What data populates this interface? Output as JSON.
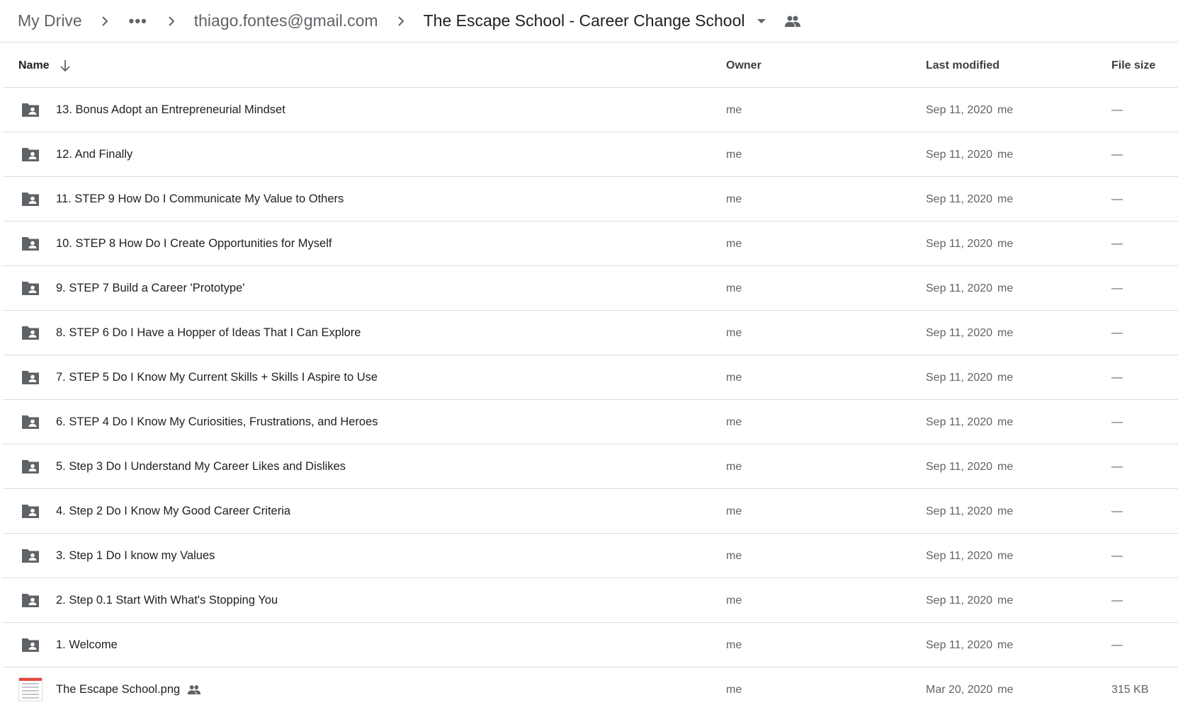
{
  "breadcrumb": {
    "root": "My Drive",
    "overflow": "•••",
    "account": "thiago.fontes@gmail.com",
    "current": "The Escape School - Career Change School"
  },
  "columns": {
    "name": "Name",
    "owner": "Owner",
    "last_modified": "Last modified",
    "file_size": "File size"
  },
  "rows": [
    {
      "name": "13. Bonus Adopt an Entrepreneurial Mindset",
      "owner": "me",
      "date": "Sep 11, 2020",
      "by": "me",
      "size": "—",
      "type": "shared-folder"
    },
    {
      "name": "12. And Finally",
      "owner": "me",
      "date": "Sep 11, 2020",
      "by": "me",
      "size": "—",
      "type": "shared-folder"
    },
    {
      "name": "11. STEP 9 How Do I Communicate My Value to Others",
      "owner": "me",
      "date": "Sep 11, 2020",
      "by": "me",
      "size": "—",
      "type": "shared-folder"
    },
    {
      "name": "10. STEP 8 How Do I Create Opportunities for Myself",
      "owner": "me",
      "date": "Sep 11, 2020",
      "by": "me",
      "size": "—",
      "type": "shared-folder"
    },
    {
      "name": "9. STEP 7 Build a Career 'Prototype'",
      "owner": "me",
      "date": "Sep 11, 2020",
      "by": "me",
      "size": "—",
      "type": "shared-folder"
    },
    {
      "name": "8. STEP 6 Do I Have a Hopper of Ideas That I Can Explore",
      "owner": "me",
      "date": "Sep 11, 2020",
      "by": "me",
      "size": "—",
      "type": "shared-folder"
    },
    {
      "name": "7. STEP 5 Do I Know My Current Skills + Skills I Aspire to Use",
      "owner": "me",
      "date": "Sep 11, 2020",
      "by": "me",
      "size": "—",
      "type": "shared-folder"
    },
    {
      "name": "6. STEP 4 Do I Know My Curiosities, Frustrations, and Heroes",
      "owner": "me",
      "date": "Sep 11, 2020",
      "by": "me",
      "size": "—",
      "type": "shared-folder"
    },
    {
      "name": "5. Step 3 Do I Understand My Career Likes and Dislikes",
      "owner": "me",
      "date": "Sep 11, 2020",
      "by": "me",
      "size": "—",
      "type": "shared-folder"
    },
    {
      "name": "4. Step 2 Do I Know My Good Career Criteria",
      "owner": "me",
      "date": "Sep 11, 2020",
      "by": "me",
      "size": "—",
      "type": "shared-folder"
    },
    {
      "name": "3. Step 1 Do I know my Values",
      "owner": "me",
      "date": "Sep 11, 2020",
      "by": "me",
      "size": "—",
      "type": "shared-folder"
    },
    {
      "name": "2. Step 0.1 Start With What's Stopping You",
      "owner": "me",
      "date": "Sep 11, 2020",
      "by": "me",
      "size": "—",
      "type": "shared-folder"
    },
    {
      "name": "1. Welcome",
      "owner": "me",
      "date": "Sep 11, 2020",
      "by": "me",
      "size": "—",
      "type": "shared-folder"
    },
    {
      "name": "The Escape School.png",
      "owner": "me",
      "date": "Mar 20, 2020",
      "by": "me",
      "size": "315 KB",
      "type": "image-file",
      "shared": true
    }
  ],
  "colors": {
    "icon": "#5f6368",
    "divider": "#dadce0",
    "text": "#202124"
  }
}
